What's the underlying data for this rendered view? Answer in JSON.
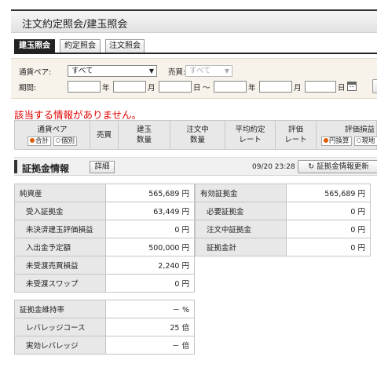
{
  "page": {
    "title": "注文約定照会/建玉照会"
  },
  "tabs": [
    {
      "label": "建玉照会",
      "active": true
    },
    {
      "label": "約定照会",
      "active": false
    },
    {
      "label": "注文照会",
      "active": false
    }
  ],
  "filter": {
    "pair_label": "通貨ペア:",
    "pair_value": "すべて",
    "side_label": "売買:",
    "side_value": "すべて",
    "period_label": "期間:",
    "year": "年",
    "month": "月",
    "day": "日",
    "tilde": "～"
  },
  "no_data_message": "該当する情報がありません。",
  "table_header": {
    "currency_pair": "通貨ペア",
    "radio_total": "合計",
    "radio_individual": "個別",
    "side": "売買",
    "position_qty_1": "建玉",
    "position_qty_2": "数量",
    "ordering_qty_1": "注文中",
    "ordering_qty_2": "数量",
    "avg_rate_1": "平均約定",
    "avg_rate_2": "レート",
    "eval_rate_1": "評価",
    "eval_rate_2": "レート",
    "pl_label": "評価損益",
    "radio_yen": "円換算",
    "radio_local": "現地"
  },
  "margin": {
    "title": "証拠金情報",
    "detail_button": "詳細",
    "timestamp": "09/20 23:28",
    "refresh_button": "証拠金情報更新",
    "left_rows": [
      {
        "label": "純資産",
        "value": "565,689 円"
      },
      {
        "label": "受入証拠金",
        "value": "63,449 円"
      },
      {
        "label": "未決済建玉評価損益",
        "value": "0 円"
      },
      {
        "label": "入出金予定額",
        "value": "500,000 円"
      },
      {
        "label": "未受渡売買損益",
        "value": "2,240 円"
      },
      {
        "label": "未受渡スワップ",
        "value": "0 円"
      }
    ],
    "right_rows": [
      {
        "label": "有効証拠金",
        "value": "565,689 円"
      },
      {
        "label": "必要証拠金",
        "value": "0 円"
      },
      {
        "label": "注文中証拠金",
        "value": "0 円"
      },
      {
        "label": "証拠金計",
        "value": "0 円"
      }
    ],
    "ratio_rows": [
      {
        "label": "証拠金維持率",
        "value": "－ %"
      },
      {
        "label": "レバレッジコース",
        "value": "25 倍"
      },
      {
        "label": "実効レバレッジ",
        "value": "－ 倍"
      }
    ]
  }
}
